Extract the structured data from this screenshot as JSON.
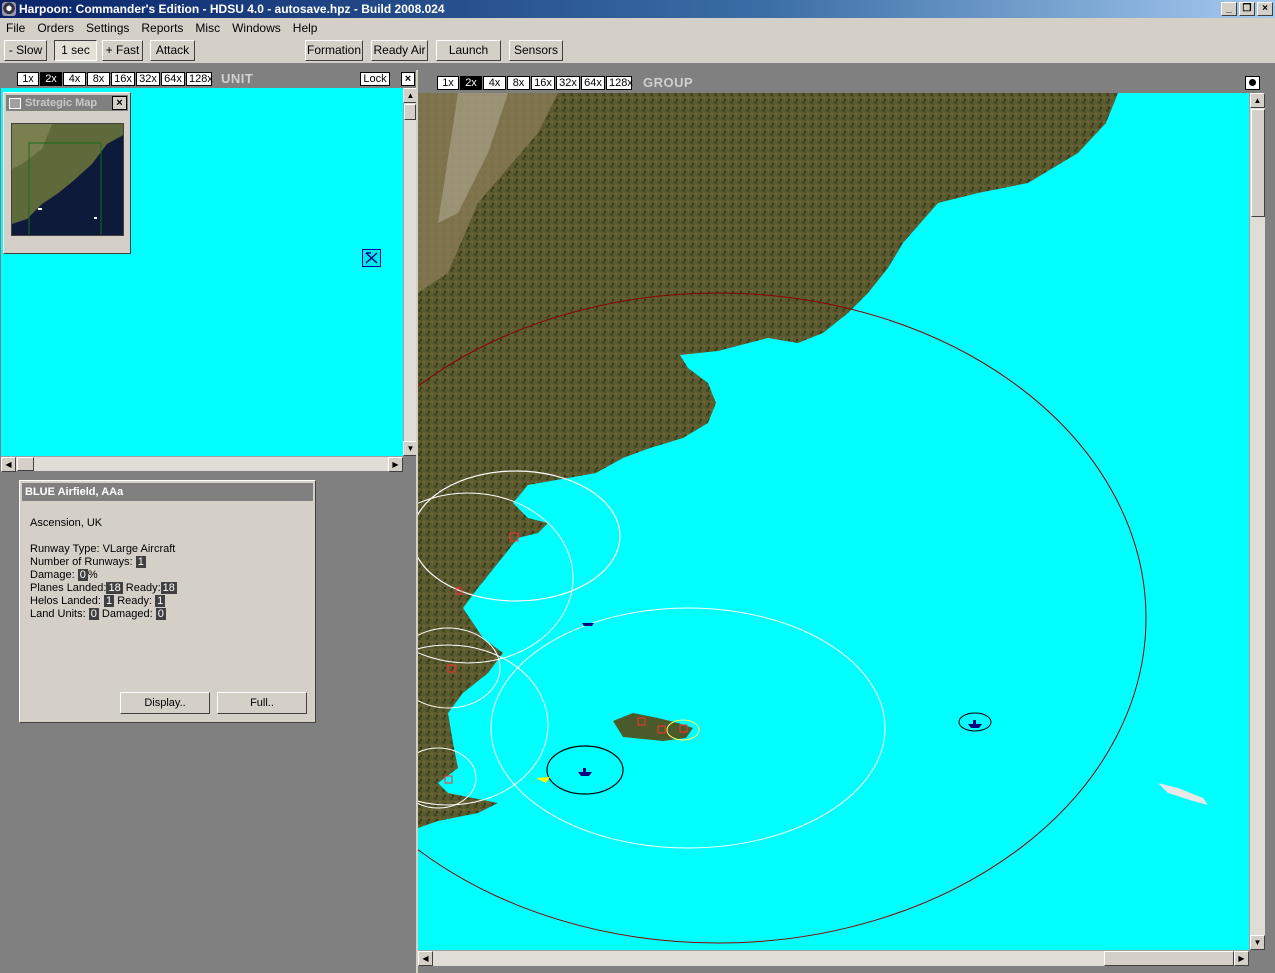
{
  "window": {
    "title": "Harpoon: Commander's Edition - HDSU 4.0 - autosave.hpz - Build 2008.024",
    "controls": [
      "_",
      "ə",
      "×"
    ]
  },
  "menu": [
    "File",
    "Orders",
    "Settings",
    "Reports",
    "Misc",
    "Windows",
    "Help"
  ],
  "toolbar": {
    "slow": "- Slow",
    "time": "1 sec",
    "fast": "+ Fast",
    "attack": "Attack",
    "formation": "Formation",
    "ready_air": "Ready Air",
    "launch": "Launch",
    "sensors": "Sensors"
  },
  "unit_panel": {
    "zoom_levels": [
      "1x",
      "2x",
      "4x",
      "8x",
      "16x",
      "32x",
      "64x",
      "128x"
    ],
    "selected_zoom": "2x",
    "label": "UNIT",
    "lock": "Lock",
    "close": "×"
  },
  "strategic_map": {
    "title": "Strategic Map",
    "close": "×"
  },
  "info": {
    "title": "BLUE Airfield, AAa",
    "location": "Ascension, UK",
    "runway_type_label": "Runway Type:",
    "runway_type": "VLarge Aircraft",
    "num_runways_label": "Number of Runways:",
    "num_runways": "1",
    "damage_label": "Damage:",
    "damage": "0",
    "damage_unit": "%",
    "planes_landed_label": "Planes Landed:",
    "planes_landed": "18",
    "planes_ready_label": "Ready:",
    "planes_ready": "18",
    "helos_landed_label": "Helos Landed:",
    "helos_landed": "1",
    "helos_ready_label": "Ready:",
    "helos_ready": "1",
    "land_units_label": "Land Units:",
    "land_units": "0",
    "damaged_label": "Damaged:",
    "damaged": "0",
    "display_button": "Display..",
    "full_button": "Full.."
  },
  "group_panel": {
    "zoom_levels": [
      "1x",
      "2x",
      "4x",
      "8x",
      "16x",
      "32x",
      "64x",
      "128x"
    ],
    "selected_zoom": "2x",
    "label": "GROUP"
  },
  "colors": {
    "ocean": "#00ffff",
    "land": "#5a5a2e",
    "range_ring": "#8b0000",
    "sensor_ring": "#ffffff",
    "friendly_unit": "#000080",
    "hostile_base": "#ff3030"
  }
}
